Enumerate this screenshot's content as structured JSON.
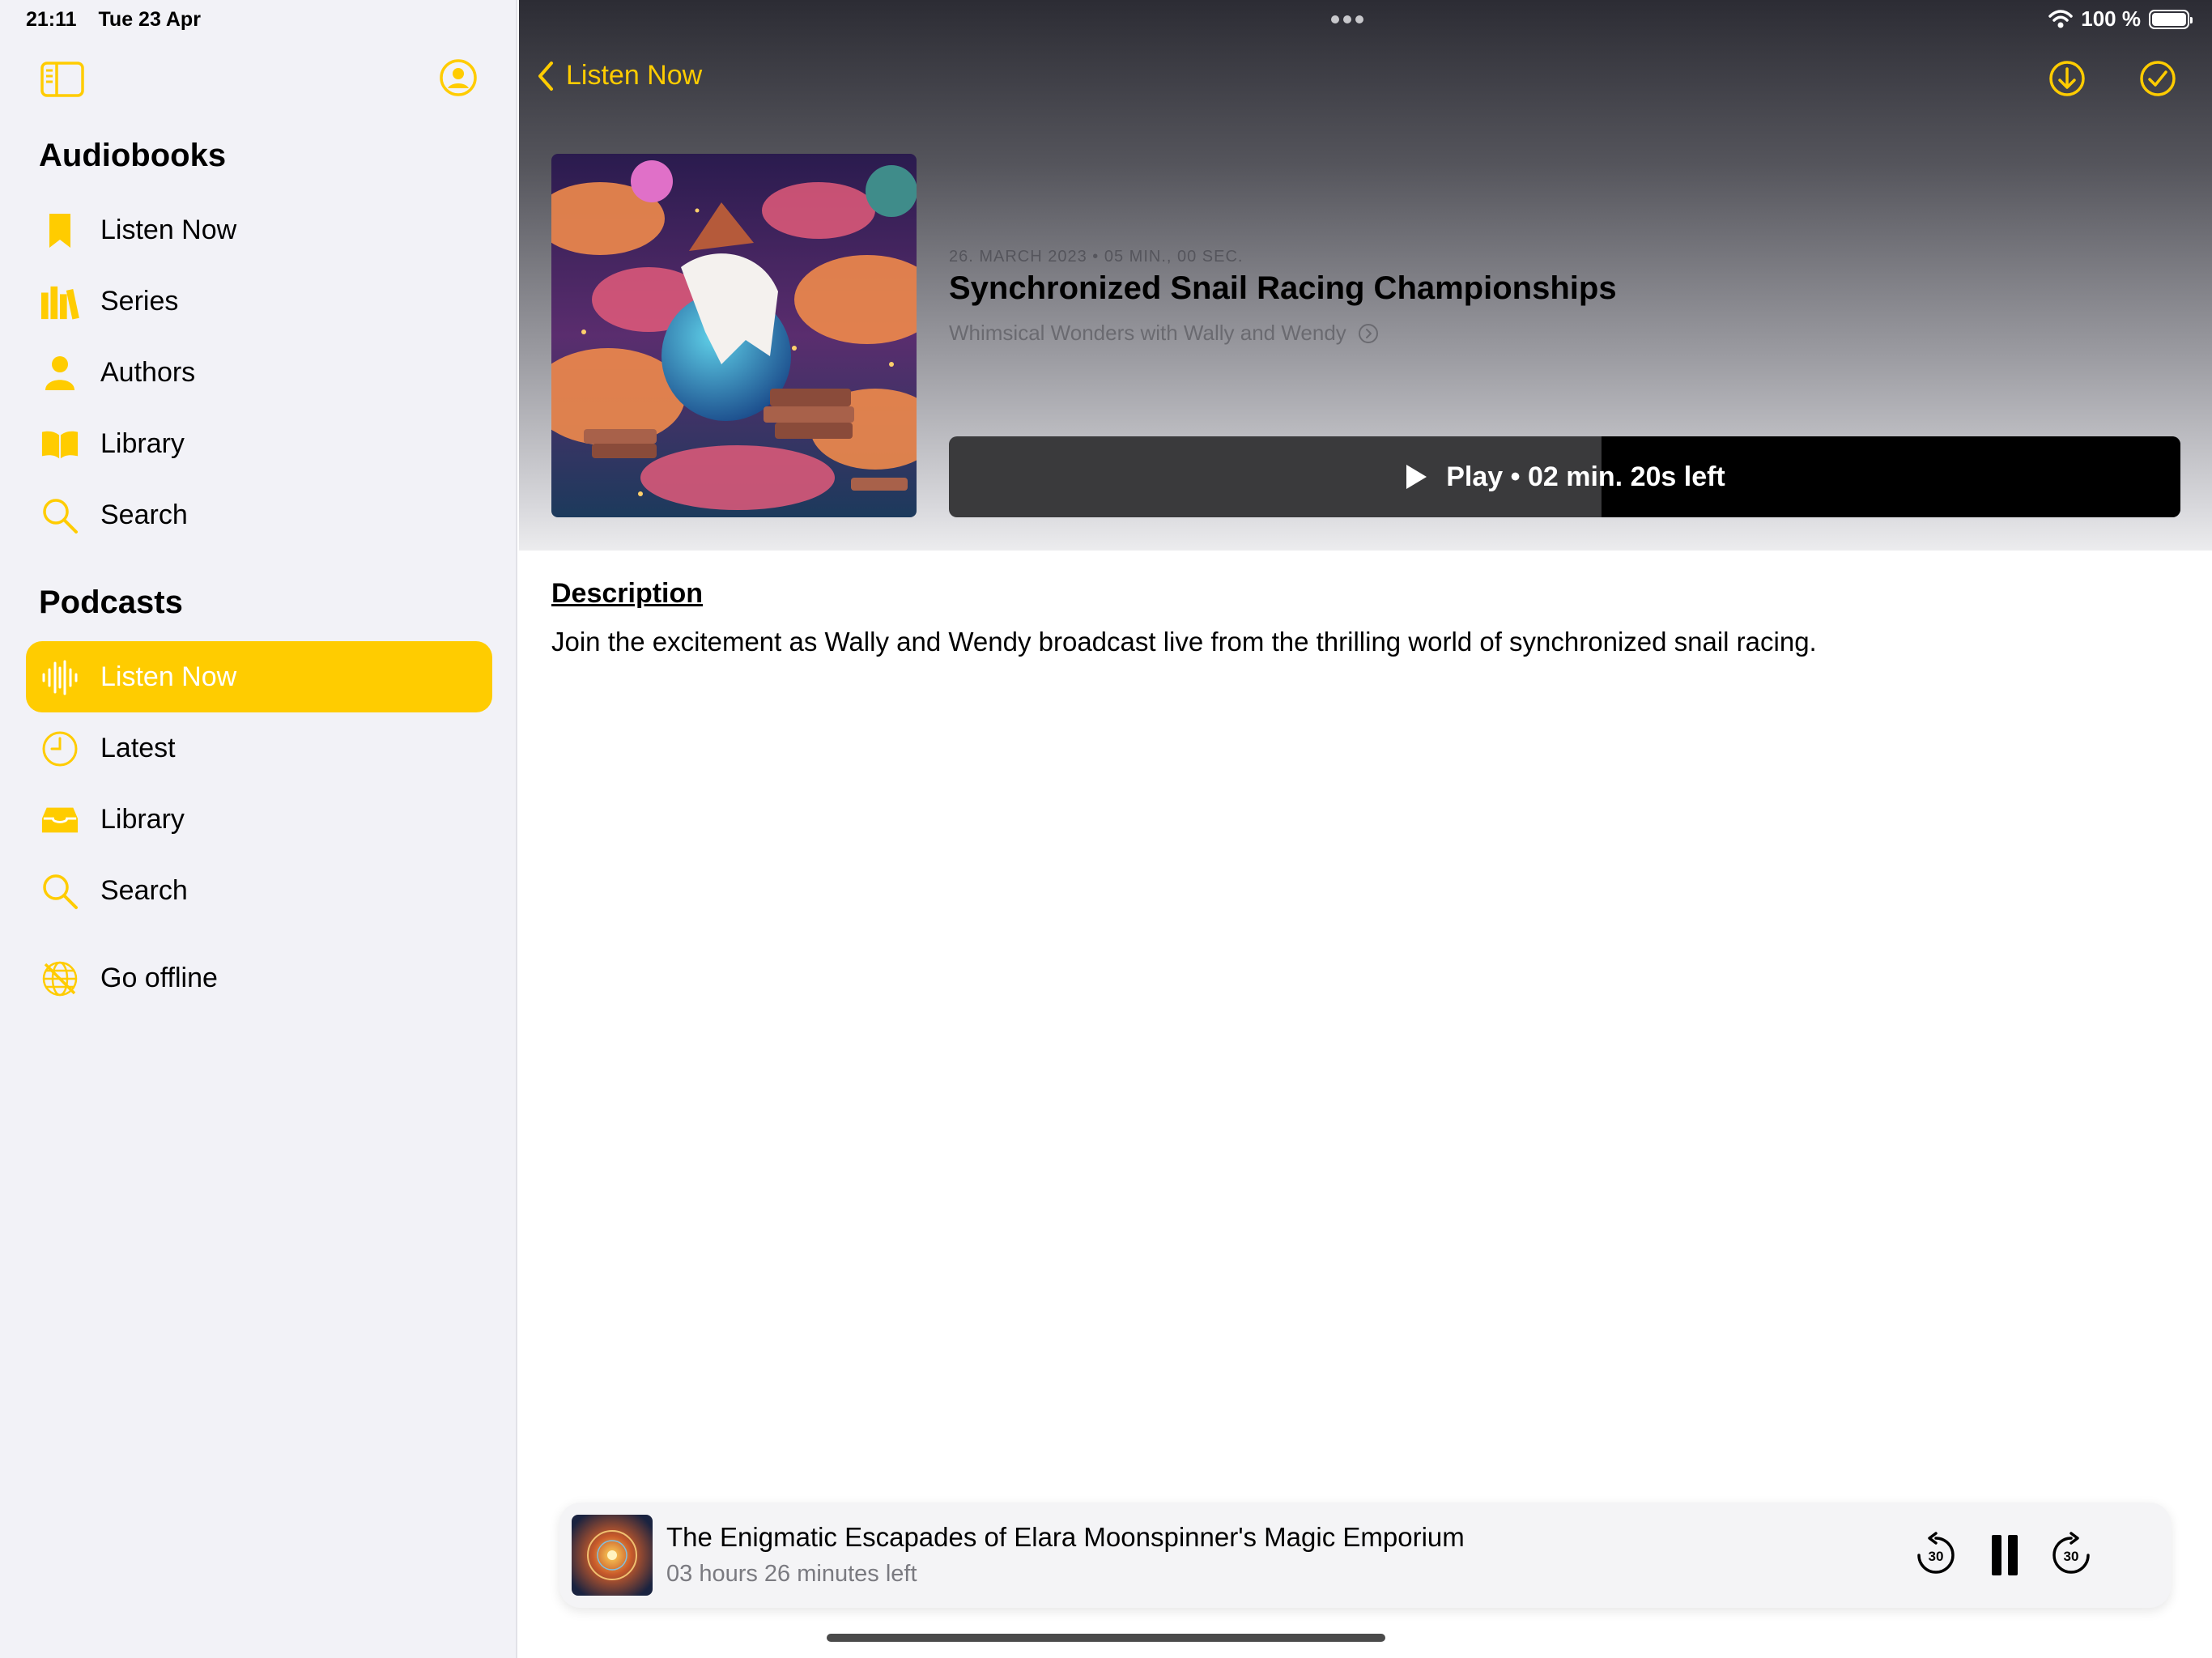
{
  "status_bar": {
    "time": "21:11",
    "date": "Tue 23 Apr",
    "battery": "100 %"
  },
  "sidebar": {
    "audiobooks_title": "Audiobooks",
    "audiobooks": [
      {
        "label": "Listen Now",
        "icon": "bookmark-icon"
      },
      {
        "label": "Series",
        "icon": "books-icon"
      },
      {
        "label": "Authors",
        "icon": "person-icon"
      },
      {
        "label": "Library",
        "icon": "open-book-icon"
      },
      {
        "label": "Search",
        "icon": "search-icon"
      }
    ],
    "podcasts_title": "Podcasts",
    "podcasts": [
      {
        "label": "Listen Now",
        "icon": "waveform-icon",
        "active": true
      },
      {
        "label": "Latest",
        "icon": "clock-icon"
      },
      {
        "label": "Library",
        "icon": "tray-icon"
      },
      {
        "label": "Search",
        "icon": "search-icon"
      }
    ],
    "offline": {
      "label": "Go offline",
      "icon": "globe-slash-icon"
    }
  },
  "header": {
    "back_label": "Listen Now"
  },
  "episode": {
    "meta": "26. MARCH 2023 • 05 MIN., 00 SEC.",
    "title": "Synchronized Snail Racing Championships",
    "show": "Whimsical Wonders with Wally and Wendy",
    "play_label": "Play • 02 min. 20s left",
    "progress_fraction": 0.53
  },
  "description": {
    "heading": "Description",
    "text": "Join the excitement as Wally and Wendy broadcast live from the thrilling world of synchronized snail racing."
  },
  "mini_player": {
    "title": "The Enigmatic Escapades of Elara Moonspinner's Magic Emporium",
    "subtitle": "03 hours 26 minutes left"
  },
  "colors": {
    "accent": "#ffcc00",
    "sidebar_bg": "#f2f2f7"
  }
}
